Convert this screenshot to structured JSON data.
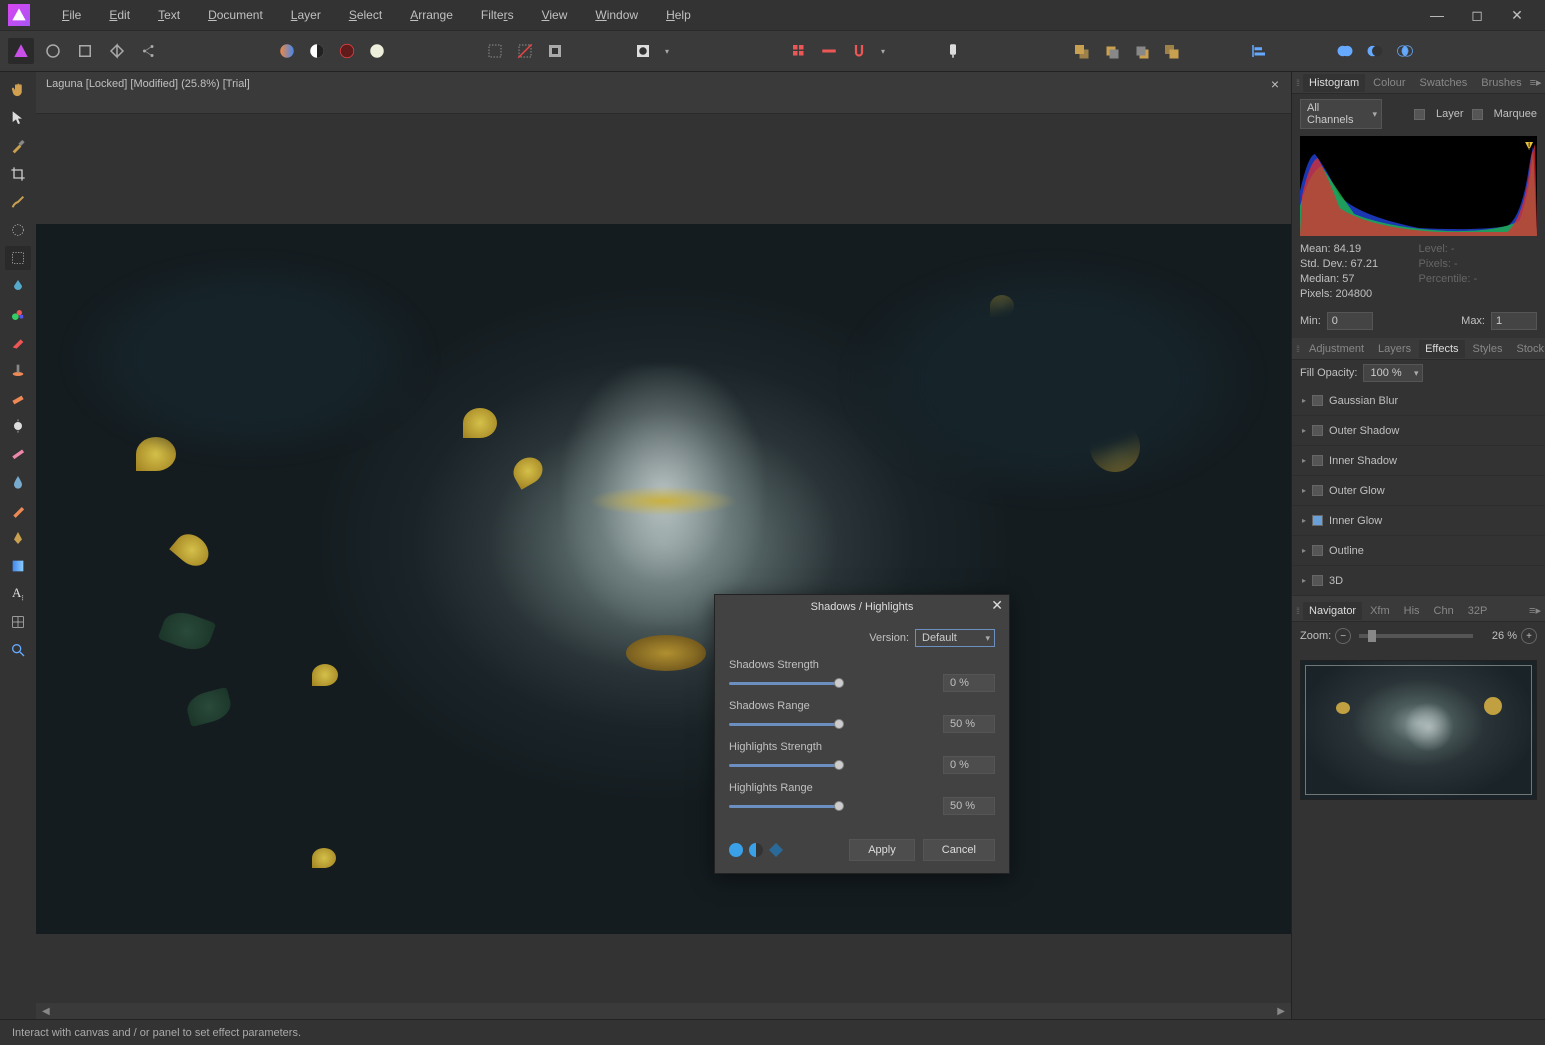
{
  "menu": {
    "items": [
      "File",
      "Edit",
      "Text",
      "Document",
      "Layer",
      "Select",
      "Arrange",
      "Filters",
      "View",
      "Window",
      "Help"
    ]
  },
  "document": {
    "tab_label": "Laguna [Locked] [Modified] (25.8%) [Trial]"
  },
  "histogram": {
    "tabs": [
      "Histogram",
      "Colour",
      "Swatches",
      "Brushes"
    ],
    "channel_dropdown": "All Channels",
    "layer_label": "Layer",
    "marquee_label": "Marquee",
    "stats": {
      "mean_label": "Mean:",
      "mean": "84.19",
      "stddev_label": "Std. Dev.:",
      "stddev": "67.21",
      "median_label": "Median:",
      "median": "57",
      "pixels_label": "Pixels:",
      "pixels": "204800",
      "level_label": "Level:",
      "level": "-",
      "pixels2_label": "Pixels:",
      "pixels2": "-",
      "percentile_label": "Percentile:",
      "percentile": "-"
    },
    "min_label": "Min:",
    "min_value": "0",
    "max_label": "Max:",
    "max_value": "1"
  },
  "effects": {
    "tabs": [
      "Adjustment",
      "Layers",
      "Effects",
      "Styles",
      "Stock"
    ],
    "fill_opacity_label": "Fill Opacity:",
    "fill_opacity_value": "100 %",
    "items": [
      {
        "label": "Gaussian Blur",
        "on": false
      },
      {
        "label": "Outer Shadow",
        "on": false
      },
      {
        "label": "Inner Shadow",
        "on": false
      },
      {
        "label": "Outer Glow",
        "on": false
      },
      {
        "label": "Inner Glow",
        "on": true
      },
      {
        "label": "Outline",
        "on": false
      },
      {
        "label": "3D",
        "on": false
      }
    ]
  },
  "navigator": {
    "tabs": [
      "Navigator",
      "Xfm",
      "His",
      "Chn",
      "32P"
    ],
    "zoom_label": "Zoom:",
    "zoom_value": "26 %"
  },
  "statusbar": {
    "hint": "Interact with canvas and / or panel to set effect parameters."
  },
  "dialog": {
    "title": "Shadows / Highlights",
    "version_label": "Version:",
    "version_value": "Default",
    "sliders": [
      {
        "label": "Shadows Strength",
        "value": "0 %"
      },
      {
        "label": "Shadows Range",
        "value": "50 %"
      },
      {
        "label": "Highlights Strength",
        "value": "0 %"
      },
      {
        "label": "Highlights Range",
        "value": "50 %"
      }
    ],
    "apply": "Apply",
    "cancel": "Cancel"
  }
}
